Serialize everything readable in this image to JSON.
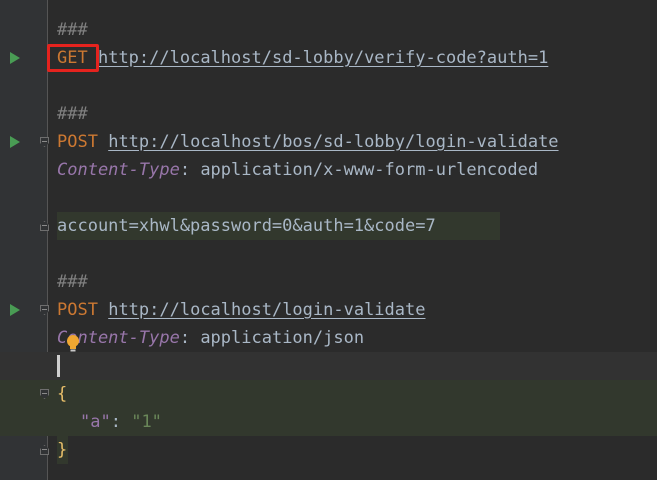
{
  "editor": {
    "lines": [
      {
        "type": "comment",
        "text": "###"
      },
      {
        "type": "request",
        "method": "GET",
        "url": "http://localhost/sd-lobby/verify-code?auth=1"
      },
      {
        "type": "comment",
        "text": "###"
      },
      {
        "type": "request",
        "method": "POST",
        "url": "http://localhost/bos/sd-lobby/login-validate"
      },
      {
        "type": "header",
        "name": "Content-Type",
        "separator": ": ",
        "value": "application/x-www-form-urlencoded"
      },
      {
        "type": "body",
        "text": "account=xhwl&password=0&auth=1&code=7"
      },
      {
        "type": "comment",
        "text": "###"
      },
      {
        "type": "request",
        "method": "POST",
        "url": "http://localhost/login-validate"
      },
      {
        "type": "header",
        "name": "Content-Type",
        "separator": ": ",
        "value": "application/json"
      },
      {
        "type": "json",
        "open_brace": "{"
      },
      {
        "type": "json",
        "key": "\"a\"",
        "separator": ": ",
        "value": "\"1\""
      },
      {
        "type": "json",
        "close_brace": "}"
      }
    ]
  },
  "icons": {
    "run": "run-request-icon",
    "fold": "fold-marker-icon",
    "intention": "lightbulb-icon"
  },
  "colors": {
    "background": "#2b2b2b",
    "gutter": "#313335",
    "method": "#cc7832",
    "header_name": "#9876aa",
    "json_string": "#6a8759",
    "run_icon": "#499c54",
    "highlight_box": "#e5231e",
    "block_highlight": "#32382d"
  }
}
